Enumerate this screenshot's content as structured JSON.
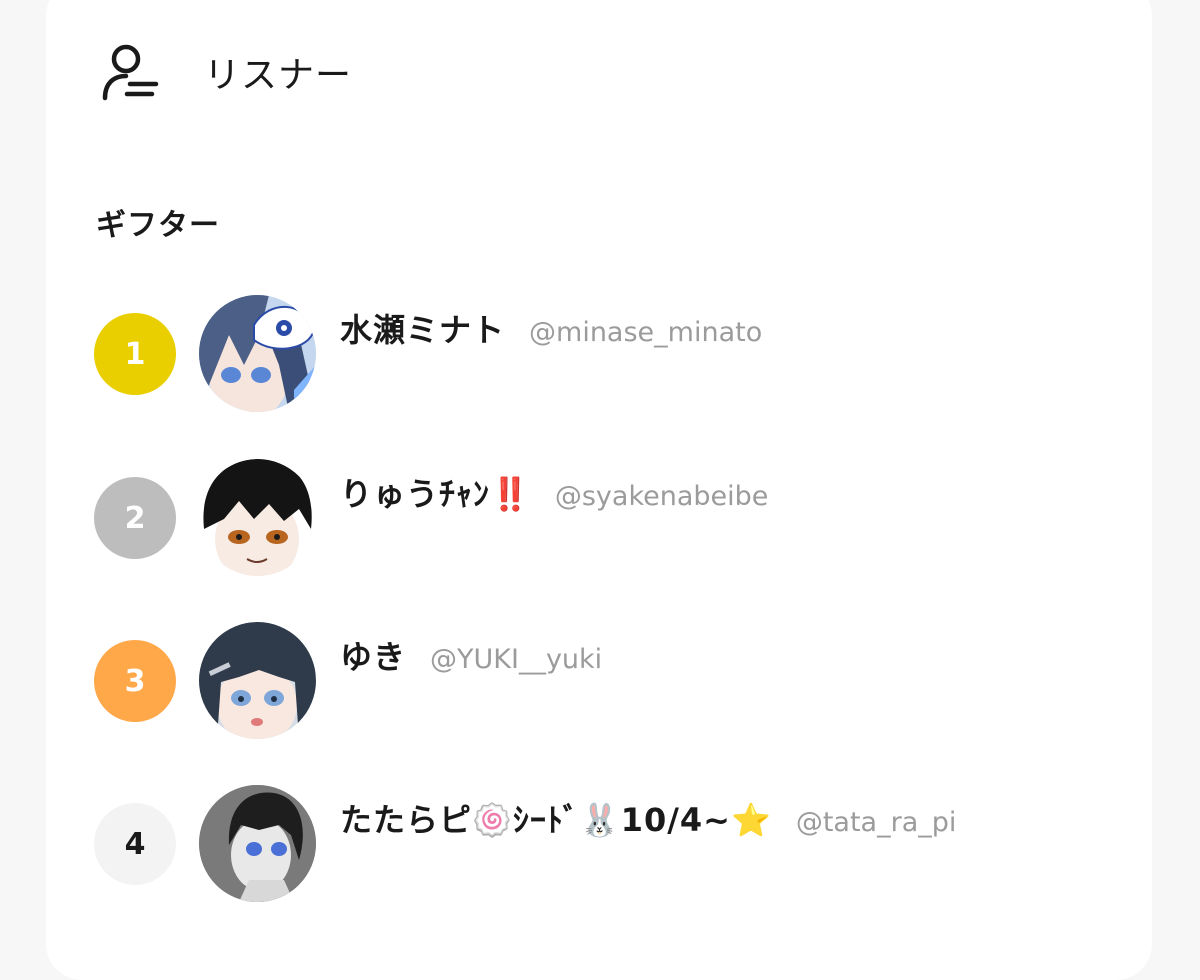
{
  "header": {
    "icon": "user-list-icon",
    "title": "リスナー"
  },
  "section": {
    "title": "ギフター"
  },
  "gifters": [
    {
      "rank": "1",
      "rank_color": "#e9cf00",
      "rank_text_color": "#ffffff",
      "avatar": "avatar-blue-hair-mask",
      "name": "水瀬ミナト",
      "handle": "@minase_minato"
    },
    {
      "rank": "2",
      "rank_color": "#bdbdbd",
      "rank_text_color": "#ffffff",
      "avatar": "avatar-black-hair",
      "name": "りゅうﾁｬﾝ‼️",
      "handle": "@syakenabeibe"
    },
    {
      "rank": "3",
      "rank_color": "#ffa84a",
      "rank_text_color": "#ffffff",
      "avatar": "avatar-dark-blue-hair",
      "name": "ゆき",
      "handle": "@YUKI__yuki"
    },
    {
      "rank": "4",
      "rank_color": "#f3f3f3",
      "rank_text_color": "#1a1a1a",
      "avatar": "avatar-monochrome",
      "name": "たたらピ🍥ｼｰﾄﾞ🐰10/4~⭐",
      "handle": "@tata_ra_pi"
    }
  ]
}
